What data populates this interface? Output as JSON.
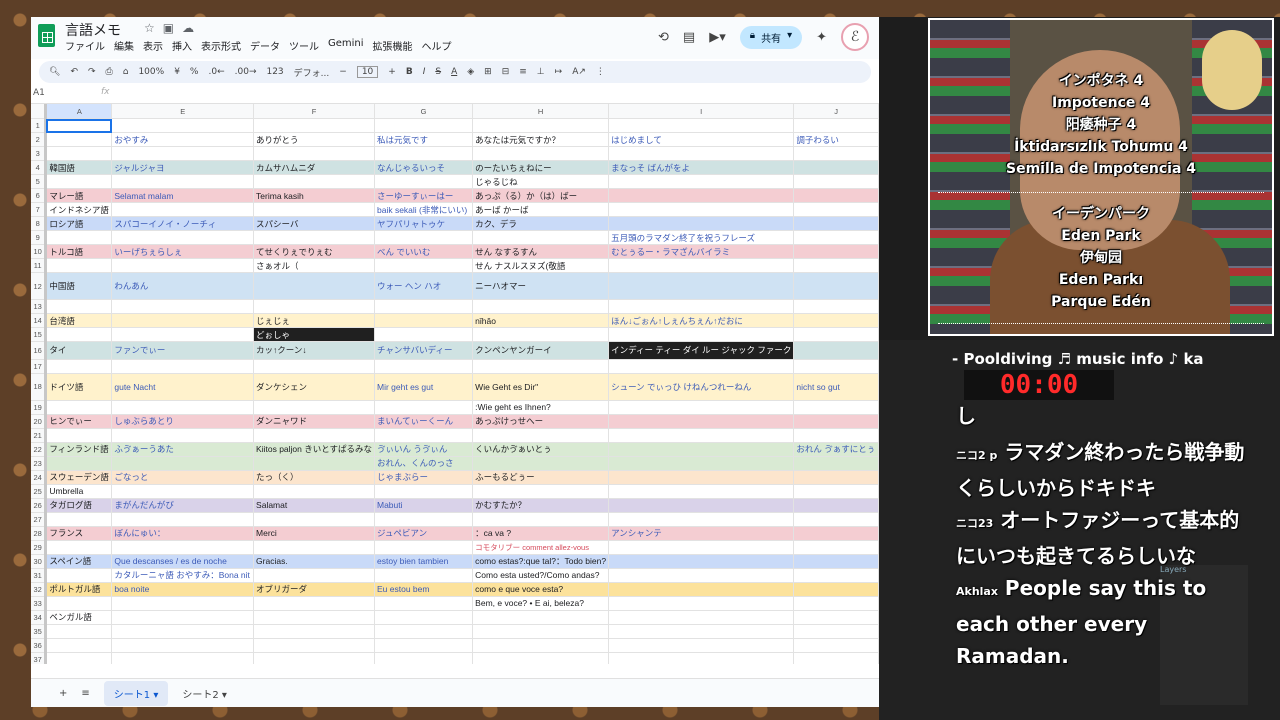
{
  "doc": {
    "title": "言語メモ"
  },
  "menus": [
    "ファイル",
    "編集",
    "表示",
    "挿入",
    "表示形式",
    "データ",
    "ツール",
    "Gemini",
    "拡張機能",
    "ヘルプ"
  ],
  "header": {
    "share": "共有"
  },
  "toolbar": {
    "zoom": "100%",
    "currency": "¥",
    "percent": "%",
    "num_format": "123",
    "font": "デフォ...",
    "font_size": "10"
  },
  "formula": {
    "name_box": "A1",
    "fx": "fx"
  },
  "columns": [
    "A",
    "E",
    "F",
    "G",
    "H",
    "I",
    "J"
  ],
  "rows": [
    {
      "n": "1",
      "c": [
        "",
        "",
        "",
        "",
        "",
        "",
        ""
      ]
    },
    {
      "n": "2",
      "c": [
        "",
        "おやすみ",
        "ありがとう",
        "私は元気です",
        "あなたは元気ですか？",
        "はじめまして",
        "調子わるい"
      ]
    },
    {
      "n": "3",
      "c": [
        "",
        "",
        "",
        "",
        "",
        "",
        ""
      ]
    },
    {
      "n": "4",
      "c": [
        "韓国語",
        "ジャルジャヨ",
        "カムサハムニダ",
        "なんじゃるいっそ",
        "のーたいちぇねにー",
        "まなっそ ばんがをよ",
        ""
      ]
    },
    {
      "n": "5",
      "c": [
        "",
        "",
        "",
        "",
        "じゃるじね",
        "",
        ""
      ]
    },
    {
      "n": "6",
      "c": [
        "マレー語",
        "Selamat malam",
        "Terima kasih",
        "さーゆーすぃーはー",
        "あっぷ（る）か（は）ばー",
        "",
        ""
      ]
    },
    {
      "n": "7",
      "c": [
        "インドネシア語",
        "",
        "",
        "baik sekali (非常にいい)",
        "あーば かーば",
        "",
        ""
      ]
    },
    {
      "n": "8",
      "c": [
        "ロシア語",
        "スパコーイノイ・ノーチィ",
        "スパシーバ",
        "ヤフパリャトゥケ",
        "カク、デラ",
        "",
        ""
      ]
    },
    {
      "n": "9",
      "c": [
        "",
        "",
        "",
        "",
        "",
        "五月頭のラマダン終了を祝うフレーズ",
        ""
      ]
    },
    {
      "n": "10",
      "c": [
        "トルコ語",
        "いーげちぇらしぇ",
        "てせくりぇでりぇむ",
        "べん でいいむ",
        "せん なするすん",
        "むとぅるー・ラマざんバイラミ",
        ""
      ]
    },
    {
      "n": "11",
      "c": [
        "",
        "",
        "さぁオル（",
        "",
        "せん ナスルスヌズ(敬語",
        "",
        ""
      ]
    },
    {
      "n": "12",
      "c": [
        "中国語",
        "わんあん",
        "",
        "ウォー ヘン ハオ",
        "ニーハオマー",
        "",
        ""
      ]
    },
    {
      "n": "13",
      "c": [
        "",
        "",
        "",
        "",
        "",
        "",
        ""
      ]
    },
    {
      "n": "14",
      "c": [
        "台湾語",
        "",
        "じぇじぇ",
        "",
        "nǐhǎo",
        "ほん↓ごぉん↑しぇんちぇん↑だおに",
        ""
      ]
    },
    {
      "n": "15",
      "c": [
        "",
        "",
        "どぉしゃ",
        "",
        "",
        "",
        ""
      ]
    },
    {
      "n": "16",
      "c": [
        "タイ",
        "ファンでぃー",
        "カッ↑クーン↓",
        "チャンサバいディー",
        "クンペンヤンガーイ",
        "インディー ティー ダイ ルー ジャック ファーク",
        ""
      ]
    },
    {
      "n": "17",
      "c": [
        "",
        "",
        "",
        "",
        "",
        "",
        ""
      ]
    },
    {
      "n": "18",
      "c": [
        "ドイツ語",
        "gute Nacht",
        "ダンケシェン",
        "Mir geht es gut",
        "Wie Geht es Dir\"",
        "シューン でぃっひ けねんつれーねん",
        "nicht so gut"
      ]
    },
    {
      "n": "19",
      "c": [
        "",
        "",
        "",
        "",
        ":Wie geht es Ihnen?",
        "",
        ""
      ]
    },
    {
      "n": "20",
      "c": [
        "ヒンでぃー",
        "しゅぶらあとり",
        "ダンニャワド",
        "まいんてぃーくーん",
        "あっぷけっせへー",
        "",
        ""
      ]
    },
    {
      "n": "21",
      "c": [
        "",
        "",
        "",
        "",
        "",
        "",
        ""
      ]
    },
    {
      "n": "22",
      "c": [
        "フィンランド語",
        "ふゔぁーうあた",
        "Kiitos paljon きいとすぱるみな",
        "ゔぃいん うゔぃん",
        "くいんかゔぁいとぅ",
        "",
        "おれん ゔぁすにとぅ"
      ]
    },
    {
      "n": "23",
      "c": [
        "",
        "",
        "",
        "おれん、くんのっさ",
        "",
        "",
        ""
      ]
    },
    {
      "n": "24",
      "c": [
        "スウェーデン語",
        "ごなっと",
        "たっ（く）",
        "じゃまぶらー",
        "ふーもるどぅー",
        "",
        ""
      ]
    },
    {
      "n": "25",
      "c": [
        "Umbrella",
        "",
        "",
        "",
        "",
        "",
        ""
      ]
    },
    {
      "n": "26",
      "c": [
        "タガログ語",
        "まがんだんがび",
        "Salamat",
        "Mabuti",
        "かむすたか？",
        "",
        ""
      ]
    },
    {
      "n": "27",
      "c": [
        "",
        "",
        "",
        "",
        "",
        "",
        ""
      ]
    },
    {
      "n": "28",
      "c": [
        "フランス",
        "ぼんにゅい：",
        "Merci",
        "ジュペビアン",
        "：ca va ?",
        "アンシャンテ",
        ""
      ]
    },
    {
      "n": "29",
      "c": [
        "",
        "",
        "",
        "",
        "コモタリブー comment allez-vous",
        "",
        ""
      ]
    },
    {
      "n": "30",
      "c": [
        "スペイン語",
        "Que descanses / es de noche",
        "Gracias.",
        "estoy bien tambien",
        "como estas?:que tal?：Todo bien?",
        "",
        ""
      ]
    },
    {
      "n": "31",
      "c": [
        "",
        "カタルーニャ語 おやすみ：Bona nit",
        "",
        "",
        "Como esta usted?/Como andas?",
        "",
        ""
      ]
    },
    {
      "n": "32",
      "c": [
        "ポルトガル語",
        "boa noite",
        "オブリガーダ",
        "Eu estou bem",
        "como e que voce esta?",
        "",
        ""
      ]
    },
    {
      "n": "33",
      "c": [
        "",
        "",
        "",
        "",
        "Bem, e voce? • E ai, beleza?",
        "",
        ""
      ]
    },
    {
      "n": "34",
      "c": [
        "ベンガル語",
        "",
        "",
        "",
        "",
        "",
        ""
      ]
    },
    {
      "n": "35",
      "c": [
        "",
        "",
        "",
        "",
        "",
        "",
        ""
      ]
    },
    {
      "n": "36",
      "c": [
        "",
        "",
        "",
        "",
        "",
        "",
        ""
      ]
    },
    {
      "n": "37",
      "c": [
        "",
        "",
        "",
        "",
        "",
        "",
        ""
      ]
    }
  ],
  "sheet_tabs": [
    "シート1",
    "シート2"
  ],
  "stream": {
    "caption1": [
      "インポタネ 4",
      "Impotence 4",
      "阳痿种子 4",
      "İktidarsızlık Tohumu 4",
      "Semilla de Impotencia 4"
    ],
    "caption2": [
      "イーデンパーク",
      "Eden Park",
      "伊甸园",
      "Eden Parkı",
      "Parque Edén"
    ],
    "ticker": "- Pooldiving   ♬ music info ♪ ka",
    "timer": "00:00",
    "chat": [
      {
        "name": "",
        "text": "し"
      },
      {
        "name": "ニコ2 p",
        "text": "ラマダン終わったら戦争動くらしいからドキドキ"
      },
      {
        "name": "ニコ23",
        "text": "オートファジーって基本的にいつも起きてるらしいな"
      },
      {
        "name": "Akhlax",
        "text": "People say this to each other every Ramadan."
      }
    ],
    "layers_label": "Layers"
  }
}
